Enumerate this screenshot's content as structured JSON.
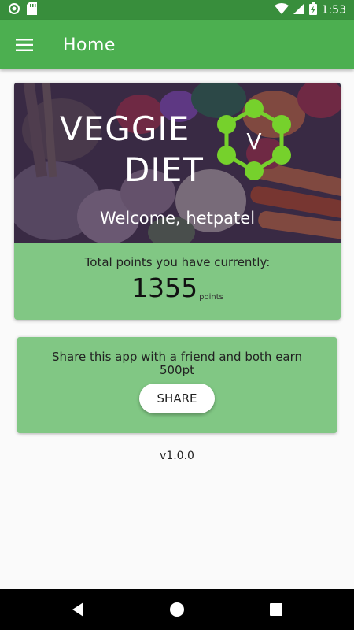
{
  "status_bar": {
    "time": "1:53",
    "battery_icon": "battery-charging-icon",
    "wifi_icon": "wifi-icon",
    "signal_icon": "signal-icon"
  },
  "app_bar": {
    "title": "Home",
    "menu_icon": "hamburger-menu-icon",
    "color": "#4caf50"
  },
  "hero": {
    "logo_line1": "VEGGIE",
    "logo_line2": "DIET",
    "logo_badge": "V",
    "welcome": "Welcome, hetpatel"
  },
  "points": {
    "caption": "Total points you have currently:",
    "value": "1355",
    "unit": "points"
  },
  "share": {
    "text": "Share this app with a friend and both earn 500pt",
    "button_label": "SHARE"
  },
  "version": "v1.0.0",
  "colors": {
    "accent_green": "#81c784",
    "logo_green": "#76d12c",
    "status_green": "#388e3c"
  }
}
